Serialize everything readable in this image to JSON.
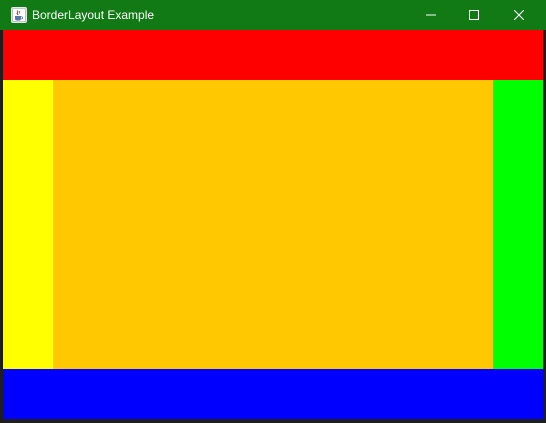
{
  "window": {
    "title": "BorderLayout Example",
    "icon": "java-cup-icon",
    "controls": {
      "minimize_icon": "minimize-icon",
      "maximize_icon": "maximize-icon",
      "close_icon": "close-icon"
    },
    "titlebar_color": "#117a15"
  },
  "regions": {
    "north": {
      "color": "#ff0000"
    },
    "west": {
      "color": "#ffff00"
    },
    "center": {
      "color": "#ffc800"
    },
    "east": {
      "color": "#00ff00"
    },
    "south": {
      "color": "#0000ff"
    }
  }
}
